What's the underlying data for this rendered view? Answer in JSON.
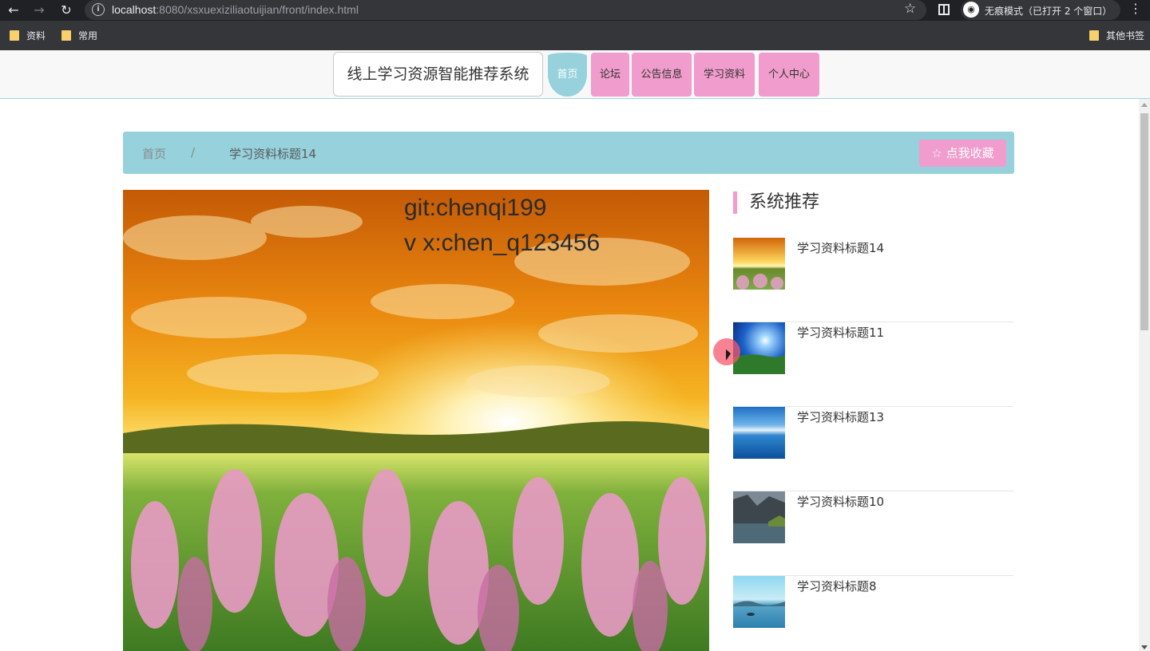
{
  "browser": {
    "url_host": "localhost",
    "url_rest": ":8080/xsxuexiziliaotuijian/front/index.html",
    "incognito_label": "无痕模式（已打开 2 个窗口）",
    "bookmarks": [
      "资料",
      "常用"
    ],
    "other_bookmarks": "其他书签"
  },
  "site": {
    "title": "线上学习资源智能推荐系统",
    "nav": [
      {
        "label": "首页",
        "active": true
      },
      {
        "label": "论坛",
        "active": false
      },
      {
        "label": "公告信息",
        "active": false
      },
      {
        "label": "学习资料",
        "active": false
      },
      {
        "label": "个人中心",
        "active": false
      }
    ]
  },
  "breadcrumb": {
    "home": "首页",
    "separator": "/",
    "current": "学习资料标题14"
  },
  "favorite_button": "☆ 点我收藏",
  "watermark": {
    "line1": "git:chenqi199",
    "line2": "v x:chen_q123456"
  },
  "recommend": {
    "title": "系统推荐",
    "items": [
      {
        "label": "学习资料标题14",
        "thumb": "sunset-meadow"
      },
      {
        "label": "学习资料标题11",
        "thumb": "blue-sky-field"
      },
      {
        "label": "学习资料标题13",
        "thumb": "ocean-clouds"
      },
      {
        "label": "学习资料标题10",
        "thumb": "mountain-lake"
      },
      {
        "label": "学习资料标题8",
        "thumb": "blue-lake"
      }
    ]
  },
  "colors": {
    "accent_teal": "#96d1dc",
    "accent_pink": "#f09ccc"
  }
}
